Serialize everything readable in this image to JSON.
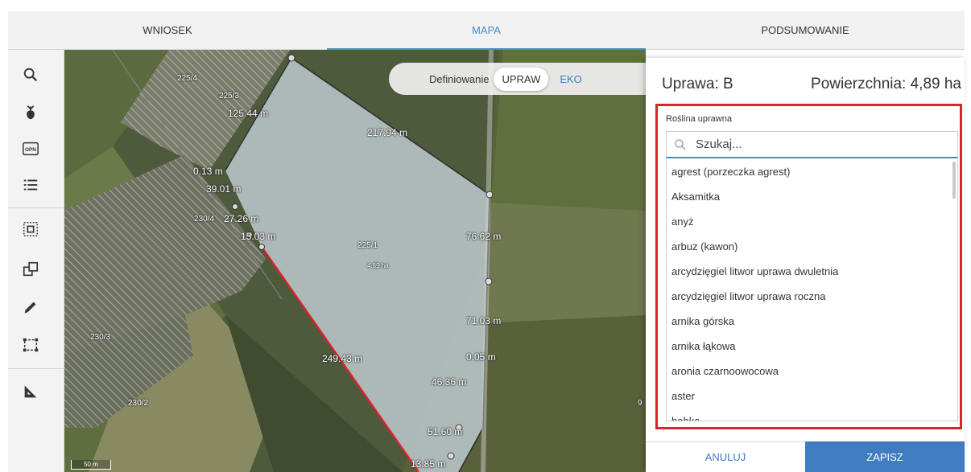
{
  "tabs": [
    {
      "label": "WNIOSEK"
    },
    {
      "label": "MAPA"
    },
    {
      "label": "PODSUMOWANIE"
    }
  ],
  "toolbar": {
    "tools": [
      "search-icon",
      "plant-icon",
      "opn-icon",
      "list-icon",
      "select-area-icon",
      "copy-shapes-icon",
      "pencil-icon",
      "selection-rect-icon",
      "measure-icon"
    ],
    "opn_label": "OPN"
  },
  "map": {
    "mode": {
      "label": "Definiowanie",
      "upraw": "UPRAW",
      "eko": "EKO"
    },
    "parcels": [
      {
        "text": "225/4"
      },
      {
        "text": "225/3"
      },
      {
        "text": "230/4"
      },
      {
        "text": "225/1"
      },
      {
        "text": "230/3"
      },
      {
        "text": "230/2"
      }
    ],
    "area": "4.89 ha",
    "measurements": [
      "125.44 m",
      "217.94 m",
      "0.13 m",
      "39.01 m",
      "27.26 m",
      "15.03 m",
      "76.62 m",
      "71.03 m",
      "249.43 m",
      "0.05 m",
      "46.36 m",
      "51.60 m",
      "13.85 m"
    ],
    "edge_label": "9",
    "scale": "50 m",
    "accent": "#e0202a"
  },
  "panel": {
    "title": "Uprawa: B",
    "area": "Powierzchnia: 4,89 ha",
    "field_label": "Roślina uprawna",
    "search_placeholder": "Szukaj...",
    "options": [
      "agrest (porzeczka agrest)",
      "Aksamitka",
      "anyż",
      "arbuz (kawon)",
      "arcydzięgiel litwor uprawa dwuletnia",
      "arcydzięgiel litwor uprawa roczna",
      "arnika górska",
      "arnika łąkowa",
      "aronia czarnoowocowa",
      "aster",
      "babka"
    ],
    "cancel_label": "ANULUJ",
    "save_label": "ZAPISZ",
    "accent": "#3f7cc1",
    "highlight": "#e0202a"
  }
}
